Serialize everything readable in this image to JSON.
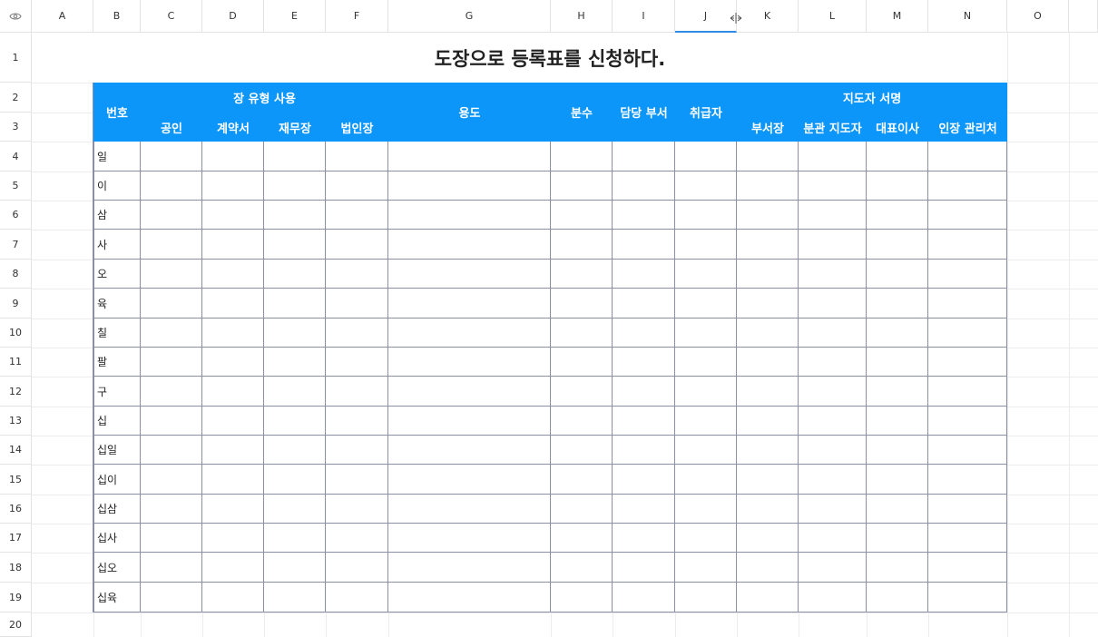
{
  "columns": [
    "A",
    "B",
    "C",
    "D",
    "E",
    "F",
    "G",
    "H",
    "I",
    "J",
    "K",
    "L",
    "M",
    "N",
    "O"
  ],
  "rows": [
    "1",
    "2",
    "3",
    "4",
    "5",
    "6",
    "7",
    "8",
    "9",
    "10",
    "11",
    "12",
    "13",
    "14",
    "15",
    "16",
    "17",
    "18",
    "19",
    "20"
  ],
  "sheet": {
    "title": "도장으로 등록표를 신청하다.",
    "header": {
      "number": "번호",
      "seal_group": "장 유형 사용",
      "seal_types": [
        "공인",
        "계약서",
        "재무장",
        "법인장"
      ],
      "purpose": "용도",
      "copies": "분수",
      "dept": "담당 부서",
      "handler": "취급자",
      "signer_group": "지도자 서명",
      "signers": [
        "부서장",
        "분관 지도자",
        "대표이사",
        "인장 관리처"
      ]
    },
    "numbers": [
      "일",
      "이",
      "삼",
      "사",
      "오",
      "육",
      "칠",
      "팔",
      "구",
      "십",
      "십일",
      "십이",
      "십삼",
      "십사",
      "십오",
      "십육"
    ]
  },
  "colors": {
    "header_bg": "#0d96fa",
    "header_text": "#ffffff",
    "table_border": "#8a8fa6",
    "selected_col": "#2d8ce6"
  },
  "icons": {
    "corner": "eye-icon",
    "resize": "column-resize-icon"
  }
}
